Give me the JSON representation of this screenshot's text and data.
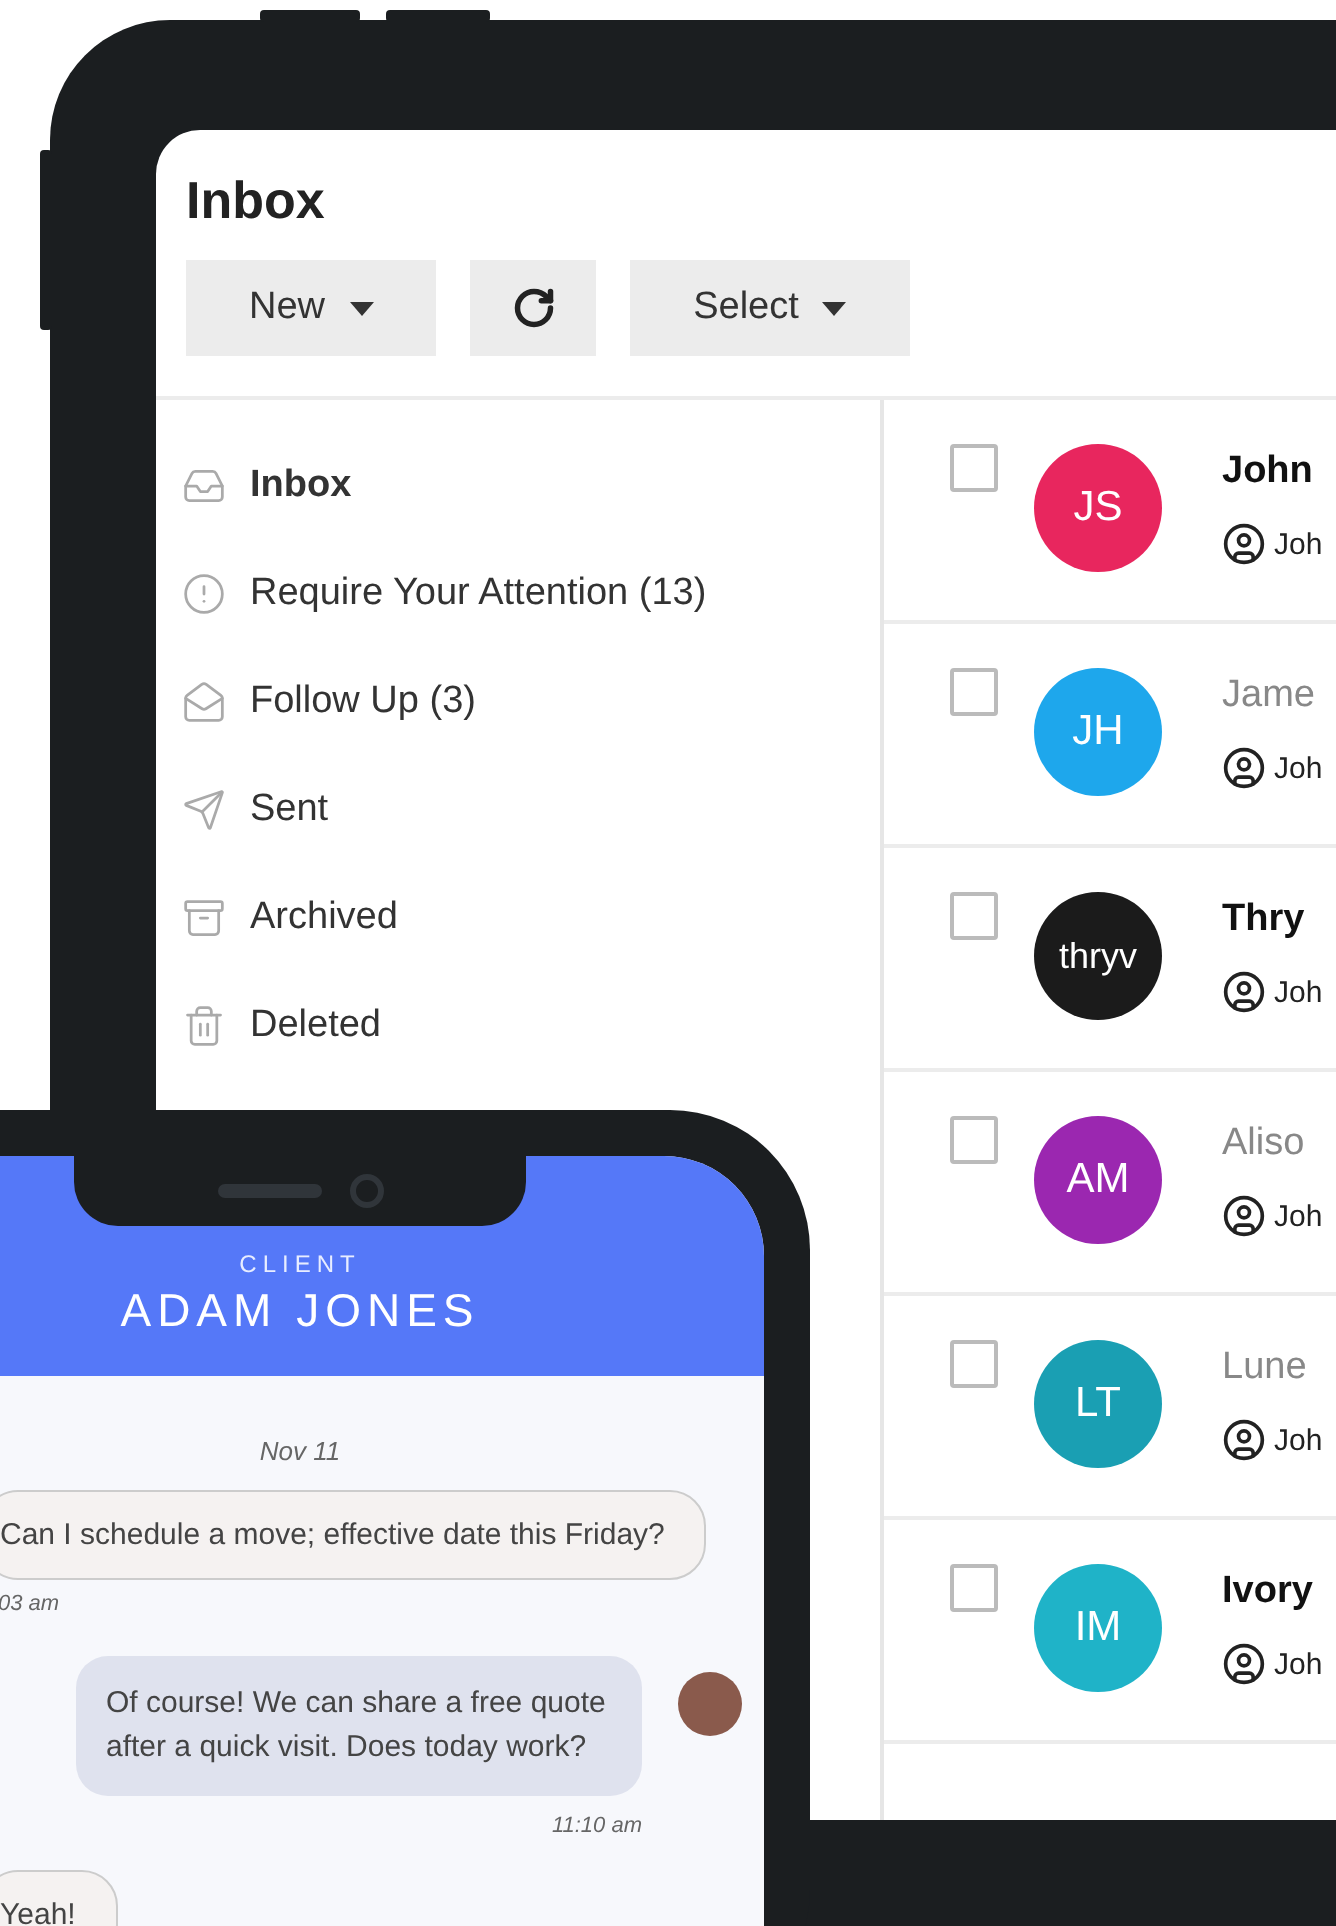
{
  "tablet": {
    "title": "Inbox",
    "toolbar": [
      {
        "kind": "dropdown",
        "label": "New"
      },
      {
        "kind": "refresh"
      },
      {
        "kind": "dropdown",
        "label": "Select"
      }
    ],
    "folders": [
      {
        "label": "Inbox",
        "selected": true
      },
      {
        "label": "Require Your Attention (13)",
        "selected": false
      },
      {
        "label": "Follow Up (3)",
        "selected": false
      },
      {
        "label": "Sent",
        "selected": false
      },
      {
        "label": "Archived",
        "selected": false
      },
      {
        "label": "Deleted",
        "selected": false
      }
    ],
    "messages": [
      {
        "checked": false,
        "avatar": {
          "kind": "initials",
          "text": "JS",
          "color": "#e8265e"
        },
        "name": "John",
        "unread": true,
        "owner": "Joh"
      },
      {
        "checked": false,
        "avatar": {
          "kind": "initials",
          "text": "JH",
          "color": "#1ea7ec"
        },
        "name": "Jame",
        "unread": false,
        "owner": "Joh"
      },
      {
        "checked": false,
        "avatar": {
          "kind": "logo",
          "text": "thryv",
          "color": "#1b1b1b"
        },
        "name": "Thry",
        "unread": true,
        "owner": "Joh"
      },
      {
        "checked": false,
        "avatar": {
          "kind": "initials",
          "text": "AM",
          "color": "#9b27b0"
        },
        "name": "Aliso",
        "unread": false,
        "owner": "Joh"
      },
      {
        "checked": false,
        "avatar": {
          "kind": "initials",
          "text": "LT",
          "color": "#1a9fb3"
        },
        "name": "Lune",
        "unread": false,
        "owner": "Joh"
      },
      {
        "checked": false,
        "avatar": {
          "kind": "initials",
          "text": "IM",
          "color": "#1fb3c8"
        },
        "name": "Ivory",
        "unread": true,
        "owner": "Joh"
      }
    ]
  },
  "phone": {
    "role": "CLIENT",
    "name": "ADAM JONES",
    "date": "Nov 11",
    "messages": [
      {
        "kind": "incoming",
        "text": "Can I schedule a move; effective date this Friday?",
        "time": "03 am"
      },
      {
        "kind": "outgoing",
        "text": "Of course! We can share a free quote after a quick visit. Does today work?",
        "time": "11:10 am"
      },
      {
        "kind": "incoming",
        "text": "Yeah!"
      }
    ]
  }
}
